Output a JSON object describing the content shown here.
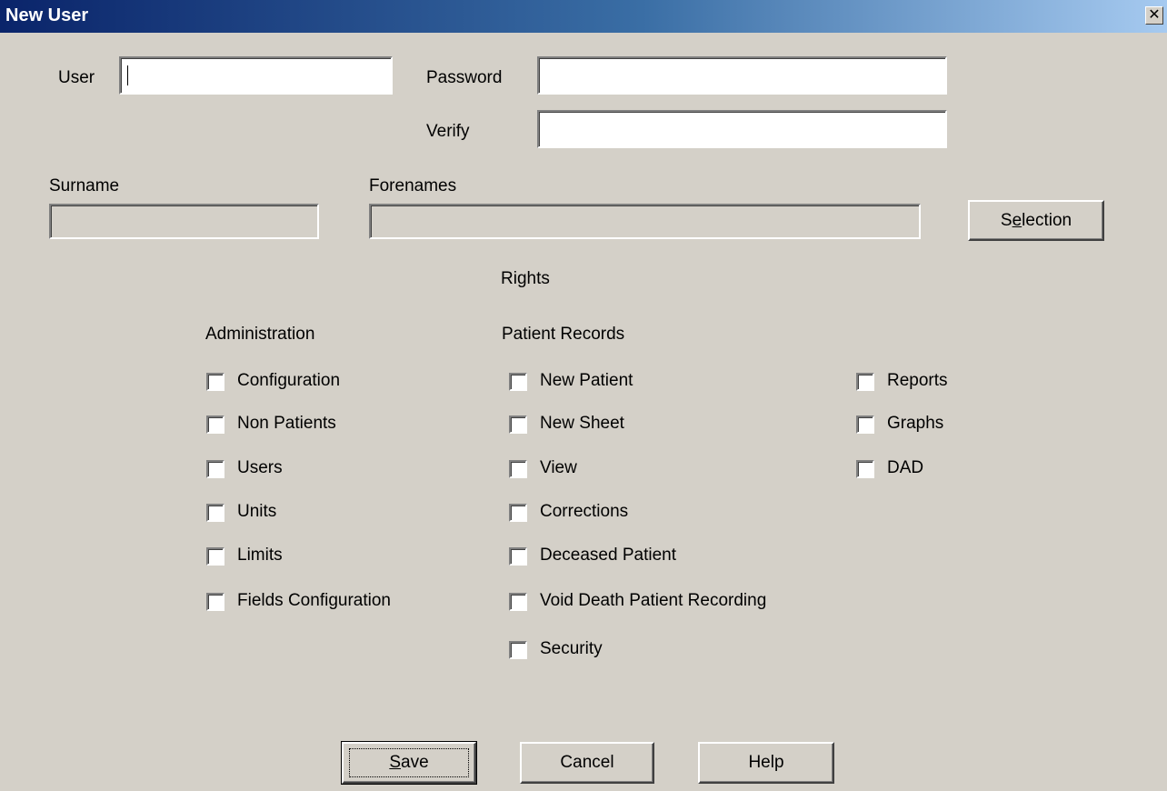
{
  "window": {
    "title": "New User",
    "close_glyph": "✕"
  },
  "form": {
    "user_label": "User",
    "user_value": "",
    "password_label": "Password",
    "password_value": "",
    "verify_label": "Verify",
    "verify_value": "",
    "surname_label": "Surname",
    "surname_value": "",
    "forenames_label": "Forenames",
    "forenames_value": "",
    "selection_button": {
      "pre": "S",
      "accel": "e",
      "post": "lection"
    }
  },
  "rights": {
    "title": "Rights",
    "administration": {
      "heading": "Administration",
      "items": [
        {
          "label": "Configuration",
          "checked": false
        },
        {
          "label": "Non Patients",
          "checked": false
        },
        {
          "label": "Users",
          "checked": false
        },
        {
          "label": "Units",
          "checked": false
        },
        {
          "label": "Limits",
          "checked": false
        },
        {
          "label": "Fields Configuration",
          "checked": false
        }
      ]
    },
    "patient_records": {
      "heading": "Patient Records",
      "items": [
        {
          "label": "New Patient",
          "checked": false
        },
        {
          "label": "New Sheet",
          "checked": false
        },
        {
          "label": "View",
          "checked": false
        },
        {
          "label": "Corrections",
          "checked": false
        },
        {
          "label": "Deceased Patient",
          "checked": false
        },
        {
          "label": "Void Death Patient Recording",
          "checked": false
        },
        {
          "label": "Security",
          "checked": false
        }
      ]
    },
    "other": {
      "items": [
        {
          "label": "Reports",
          "checked": false
        },
        {
          "label": "Graphs",
          "checked": false
        },
        {
          "label": "DAD",
          "checked": false
        }
      ]
    }
  },
  "buttons": {
    "save": {
      "accel": "S",
      "rest": "ave"
    },
    "cancel": "Cancel",
    "help": "Help"
  }
}
